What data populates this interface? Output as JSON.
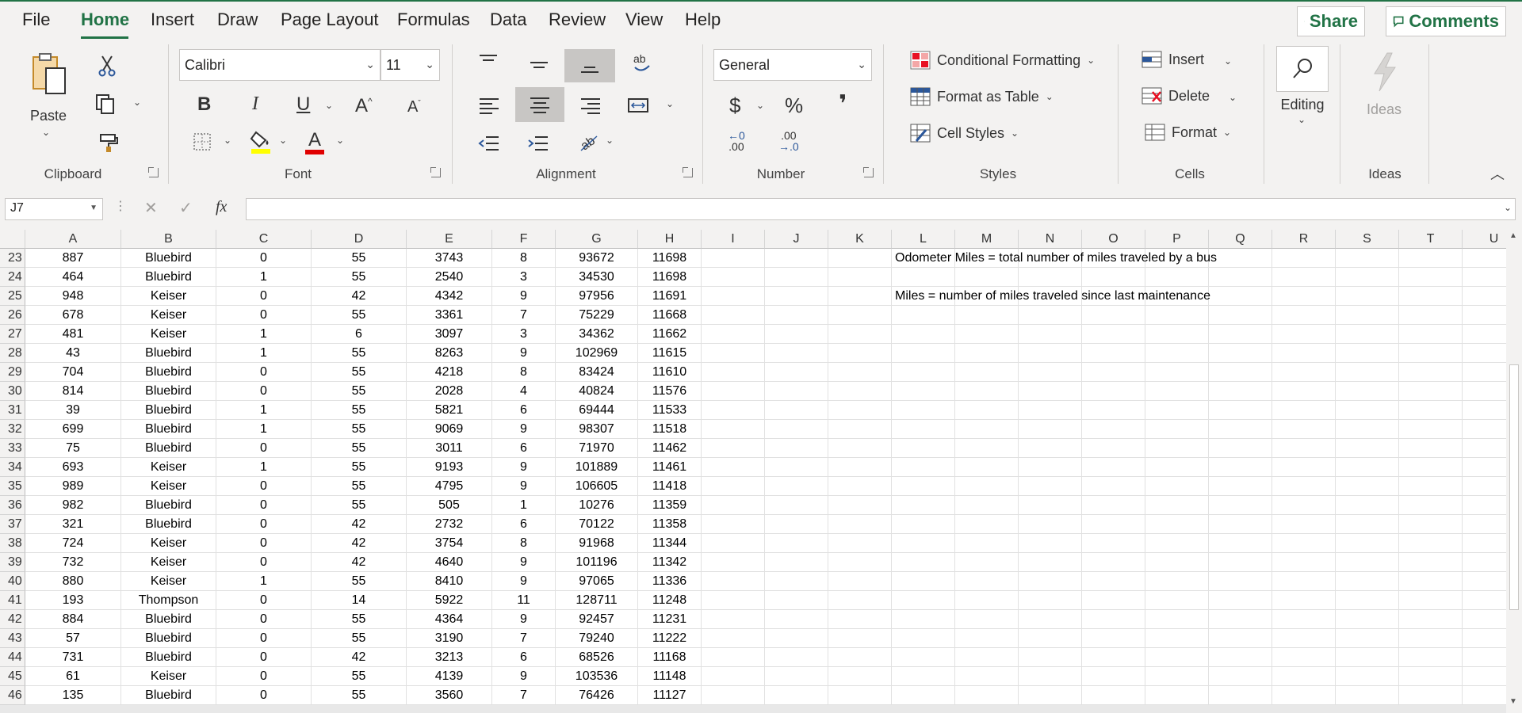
{
  "menu": {
    "tabs": [
      "File",
      "Home",
      "Insert",
      "Draw",
      "Page Layout",
      "Formulas",
      "Data",
      "Review",
      "View",
      "Help"
    ],
    "active": "Home",
    "share_label": "Share",
    "comments_label": "Comments"
  },
  "ribbon": {
    "clipboard": {
      "paste_label": "Paste",
      "group_label": "Clipboard"
    },
    "font": {
      "font_name": "Calibri",
      "font_size": "11",
      "group_label": "Font",
      "bold": "B",
      "italic": "I",
      "underline": "U",
      "grow": "A",
      "shrink": "A",
      "font_color_letter": "A"
    },
    "alignment": {
      "group_label": "Alignment"
    },
    "number": {
      "format": "General",
      "currency": "$",
      "percent": "%",
      "comma": "❜",
      "inc_decimal_top": "←0",
      "inc_decimal_bottom": ".00",
      "dec_decimal_top": ".00",
      "dec_decimal_bottom": "→.0",
      "group_label": "Number"
    },
    "styles": {
      "conditional": "Conditional Formatting",
      "format_table": "Format as Table",
      "cell_styles": "Cell Styles",
      "group_label": "Styles"
    },
    "cells": {
      "insert": "Insert",
      "delete": "Delete",
      "format": "Format",
      "group_label": "Cells"
    },
    "editing": {
      "label": "Editing"
    },
    "ideas": {
      "button_label": "Ideas",
      "group_label": "Ideas"
    }
  },
  "formula_bar": {
    "name_box": "J7",
    "cancel": "✕",
    "enter": "✓",
    "fx": "fx",
    "content": ""
  },
  "columns": [
    "A",
    "B",
    "C",
    "D",
    "E",
    "F",
    "G",
    "H",
    "I",
    "J",
    "K",
    "L",
    "M",
    "N",
    "O",
    "P",
    "Q",
    "R",
    "S",
    "T",
    "U"
  ],
  "rows": [
    {
      "n": "23",
      "cells": [
        "887",
        "Bluebird",
        "0",
        "55",
        "3743",
        "8",
        "93672",
        "11698"
      ]
    },
    {
      "n": "24",
      "cells": [
        "464",
        "Bluebird",
        "1",
        "55",
        "2540",
        "3",
        "34530",
        "11698"
      ]
    },
    {
      "n": "25",
      "cells": [
        "948",
        "Keiser",
        "0",
        "42",
        "4342",
        "9",
        "97956",
        "11691"
      ]
    },
    {
      "n": "26",
      "cells": [
        "678",
        "Keiser",
        "0",
        "55",
        "3361",
        "7",
        "75229",
        "11668"
      ]
    },
    {
      "n": "27",
      "cells": [
        "481",
        "Keiser",
        "1",
        "6",
        "3097",
        "3",
        "34362",
        "11662"
      ]
    },
    {
      "n": "28",
      "cells": [
        "43",
        "Bluebird",
        "1",
        "55",
        "8263",
        "9",
        "102969",
        "11615"
      ]
    },
    {
      "n": "29",
      "cells": [
        "704",
        "Bluebird",
        "0",
        "55",
        "4218",
        "8",
        "83424",
        "11610"
      ]
    },
    {
      "n": "30",
      "cells": [
        "814",
        "Bluebird",
        "0",
        "55",
        "2028",
        "4",
        "40824",
        "11576"
      ]
    },
    {
      "n": "31",
      "cells": [
        "39",
        "Bluebird",
        "1",
        "55",
        "5821",
        "6",
        "69444",
        "11533"
      ]
    },
    {
      "n": "32",
      "cells": [
        "699",
        "Bluebird",
        "1",
        "55",
        "9069",
        "9",
        "98307",
        "11518"
      ]
    },
    {
      "n": "33",
      "cells": [
        "75",
        "Bluebird",
        "0",
        "55",
        "3011",
        "6",
        "71970",
        "11462"
      ]
    },
    {
      "n": "34",
      "cells": [
        "693",
        "Keiser",
        "1",
        "55",
        "9193",
        "9",
        "101889",
        "11461"
      ]
    },
    {
      "n": "35",
      "cells": [
        "989",
        "Keiser",
        "0",
        "55",
        "4795",
        "9",
        "106605",
        "11418"
      ]
    },
    {
      "n": "36",
      "cells": [
        "982",
        "Bluebird",
        "0",
        "55",
        "505",
        "1",
        "10276",
        "11359"
      ]
    },
    {
      "n": "37",
      "cells": [
        "321",
        "Bluebird",
        "0",
        "42",
        "2732",
        "6",
        "70122",
        "11358"
      ]
    },
    {
      "n": "38",
      "cells": [
        "724",
        "Keiser",
        "0",
        "42",
        "3754",
        "8",
        "91968",
        "11344"
      ]
    },
    {
      "n": "39",
      "cells": [
        "732",
        "Keiser",
        "0",
        "42",
        "4640",
        "9",
        "101196",
        "11342"
      ]
    },
    {
      "n": "40",
      "cells": [
        "880",
        "Keiser",
        "1",
        "55",
        "8410",
        "9",
        "97065",
        "11336"
      ]
    },
    {
      "n": "41",
      "cells": [
        "193",
        "Thompson",
        "0",
        "14",
        "5922",
        "11",
        "128711",
        "11248"
      ]
    },
    {
      "n": "42",
      "cells": [
        "884",
        "Bluebird",
        "0",
        "55",
        "4364",
        "9",
        "92457",
        "11231"
      ]
    },
    {
      "n": "43",
      "cells": [
        "57",
        "Bluebird",
        "0",
        "55",
        "3190",
        "7",
        "79240",
        "11222"
      ]
    },
    {
      "n": "44",
      "cells": [
        "731",
        "Bluebird",
        "0",
        "42",
        "3213",
        "6",
        "68526",
        "11168"
      ]
    },
    {
      "n": "45",
      "cells": [
        "61",
        "Keiser",
        "0",
        "55",
        "4139",
        "9",
        "103536",
        "11148"
      ]
    },
    {
      "n": "46",
      "cells": [
        "135",
        "Bluebird",
        "0",
        "55",
        "3560",
        "7",
        "76426",
        "11127"
      ]
    }
  ],
  "notes": {
    "note1": "Odometer Miles = total number of miles traveled by a bus",
    "note2": "Miles = number of miles traveled since last maintenance"
  }
}
